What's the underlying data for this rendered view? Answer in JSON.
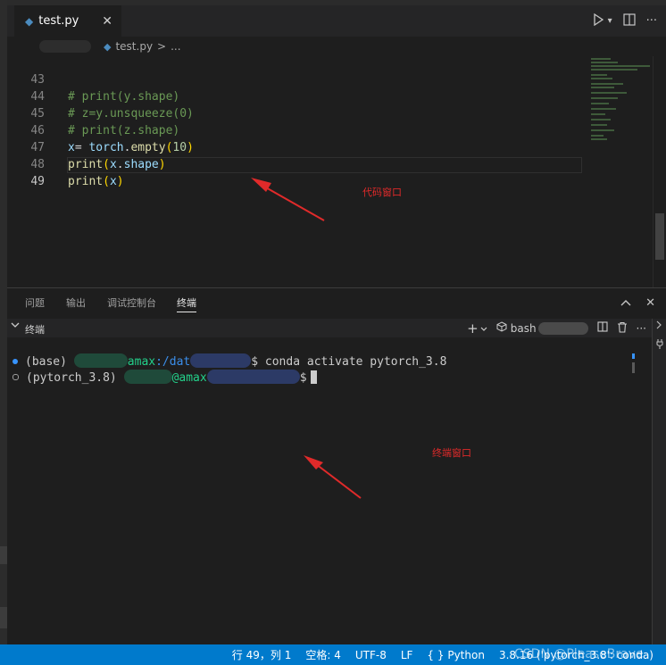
{
  "editor_tab": {
    "file_name": "test.py",
    "close_glyph": "✕",
    "file_icon": "python-file-icon"
  },
  "toolbar": {
    "run_glyph": "▷",
    "run_menu_glyph": "⌄",
    "split_glyph": "◫",
    "more_glyph": "···"
  },
  "breadcrumb": {
    "file": "test.py",
    "separator": ">",
    "ellipsis": "..."
  },
  "code": {
    "lines": [
      {
        "no": "43",
        "text": "# print(y.shape)"
      },
      {
        "no": "44",
        "text": "# z=y.unsqueeze(0)"
      },
      {
        "no": "45",
        "text": "# print(z.shape)"
      },
      {
        "no": "46",
        "text": "x= torch.empty(10)"
      },
      {
        "no": "47",
        "text": "print(x.shape)"
      },
      {
        "no": "48",
        "text": "print(x)"
      },
      {
        "no": "49",
        "text": ""
      }
    ],
    "tokens": {
      "l46_var": "x",
      "l46_eq": "= ",
      "l46_mod": "torch",
      "l46_dot": ".",
      "l46_fn": "empty",
      "l46_open": "(",
      "l46_num": "10",
      "l46_close": ")",
      "l47_fn": "print",
      "l47_open": "(",
      "l47_var": "x",
      "l47_dot": ".",
      "l47_attr": "shape",
      "l47_close": ")",
      "l48_fn": "print",
      "l48_open": "(",
      "l48_var": "x",
      "l48_close": ")"
    }
  },
  "annotations": {
    "code_window": "代码窗口",
    "terminal_window": "终端窗口",
    "arrow_color": "#e02a2a"
  },
  "panel": {
    "tabs": [
      "问题",
      "输出",
      "调试控制台",
      "终端"
    ],
    "active_tab": "终端",
    "maximize_glyph": "∧",
    "close_glyph": "✕"
  },
  "terminal": {
    "section_title": "终端",
    "collapse_glyph": "∨",
    "new_glyph": "+",
    "new_menu_glyph": "∨",
    "profile_icon": "cube-icon",
    "profile": "bash",
    "split_glyph": "◫",
    "trash_glyph": "🗑",
    "more_glyph": "···",
    "line1": {
      "env": "(base)",
      "host": "amax",
      "path": ":/dat",
      "prompt_end": "$",
      "command": "conda activate pytorch_3.8"
    },
    "line2": {
      "env": "(pytorch_3.8)",
      "host": "@amax",
      "prompt_end": "$"
    }
  },
  "status_bar": {
    "position": "行 49，列 1",
    "spaces": "空格: 4",
    "encoding": "UTF-8",
    "eol": "LF",
    "language": "Python",
    "language_icon": "{ }",
    "interpreter": "3.8.16 ('pytorch_3.8': conda)",
    "watermark": "CSDN @PleaseBrave",
    "background": "#007acc"
  }
}
